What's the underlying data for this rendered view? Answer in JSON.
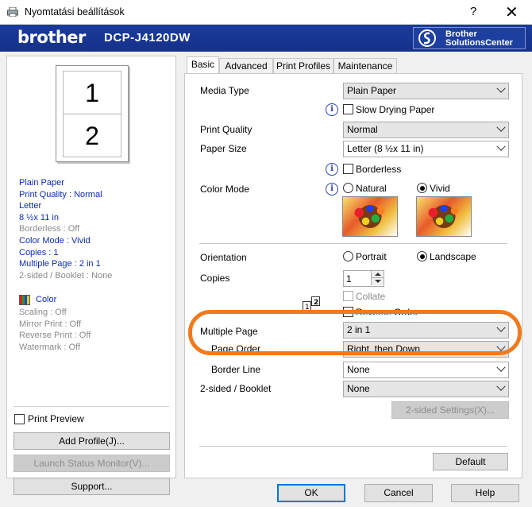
{
  "window": {
    "title": "Nyomtatási beállítások",
    "help": "?",
    "close": "✕"
  },
  "banner": {
    "brand": "brother",
    "model": "DCP-J4120DW",
    "solutions_line1": "Brother",
    "solutions_line2": "SolutionsCenter"
  },
  "preview": {
    "page1": "1",
    "page2": "2"
  },
  "summary": {
    "lines": [
      {
        "text": "Plain Paper",
        "style": "blue"
      },
      {
        "text": "Print Quality : Normal",
        "style": "blue"
      },
      {
        "text": "Letter",
        "style": "blue"
      },
      {
        "text": "8 ½x 11 in",
        "style": "blue"
      },
      {
        "text": "Borderless : Off",
        "style": "grey"
      },
      {
        "text": "Color Mode : Vivid",
        "style": "blue"
      },
      {
        "text": "Copies : 1",
        "style": "blue"
      },
      {
        "text": "Multiple Page : 2 in 1",
        "style": "blue"
      },
      {
        "text": "2-sided / Booklet : None",
        "style": "grey"
      }
    ],
    "color_label": "Color",
    "lines2": [
      {
        "text": "Scaling : Off",
        "style": "grey"
      },
      {
        "text": "Mirror Print : Off",
        "style": "grey"
      },
      {
        "text": "Reverse Print : Off",
        "style": "grey"
      },
      {
        "text": "Watermark : Off",
        "style": "grey"
      }
    ]
  },
  "left_controls": {
    "print_preview": "Print Preview",
    "add_profile": "Add Profile(J)...",
    "launch_status": "Launch Status Monitor(V)...",
    "support": "Support..."
  },
  "tabs": [
    "Basic",
    "Advanced",
    "Print Profiles",
    "Maintenance"
  ],
  "basic": {
    "media_type_label": "Media Type",
    "media_type_value": "Plain Paper",
    "slow_drying": "Slow Drying Paper",
    "print_quality_label": "Print Quality",
    "print_quality_value": "Normal",
    "paper_size_label": "Paper Size",
    "paper_size_value": "Letter (8 ½x 11 in)",
    "borderless": "Borderless",
    "color_mode_label": "Color Mode",
    "natural": "Natural",
    "vivid": "Vivid",
    "orientation_label": "Orientation",
    "portrait": "Portrait",
    "landscape": "Landscape",
    "copies_label": "Copies",
    "copies_value": "1",
    "collate": "Collate",
    "reverse_order": "Reverse Order",
    "multiple_page_label": "Multiple Page",
    "multiple_page_value": "2 in 1",
    "page_order_label": "Page Order",
    "page_order_value": "Right, then Down",
    "border_line_label": "Border Line",
    "border_line_value": "None",
    "two_sided_label": "2-sided / Booklet",
    "two_sided_value": "None",
    "two_sided_settings": "2-sided Settings(X)...",
    "default": "Default"
  },
  "footer": {
    "ok": "OK",
    "cancel": "Cancel",
    "help": "Help"
  },
  "colors": {
    "brand_blue": "#1a3b9c",
    "highlight": "#f07a1e",
    "link_blue": "#0b2bb5"
  }
}
